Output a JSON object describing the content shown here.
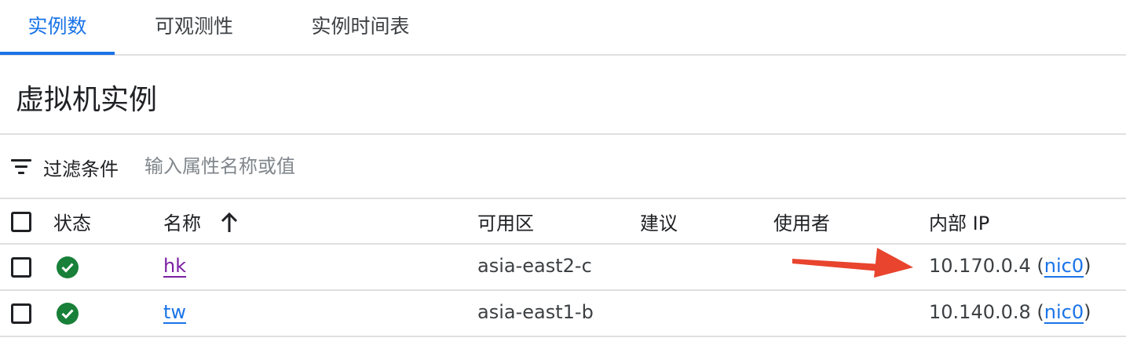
{
  "tabs": [
    {
      "label": "实例数",
      "active": true
    },
    {
      "label": "可观测性",
      "active": false
    },
    {
      "label": "实例时间表",
      "active": false
    }
  ],
  "page_title": "虚拟机实例",
  "filter": {
    "label": "过滤条件",
    "placeholder": "输入属性名称或值",
    "icon": "filter-list-icon"
  },
  "table": {
    "headers": {
      "status": "状态",
      "name": "名称",
      "zone": "可用区",
      "recommendation": "建议",
      "in_use_by": "使用者",
      "internal_ip": "内部 IP"
    },
    "sort": {
      "column": "name",
      "direction": "ascending",
      "icon": "arrow-upward-icon"
    },
    "rows": [
      {
        "status": "running",
        "status_icon": "check-circle-icon",
        "name": "hk",
        "zone": "asia-east2-c",
        "ip": "10.170.0.4",
        "ip_open": " (",
        "nic": "nic0",
        "ip_close": ")"
      },
      {
        "status": "running",
        "status_icon": "check-circle-icon",
        "name": "tw",
        "zone": "asia-east1-b",
        "ip": "10.140.0.8",
        "ip_open": " (",
        "nic": "nic0",
        "ip_close": ")"
      }
    ]
  },
  "annotation": {
    "type": "red-arrow",
    "color": "#e8442e",
    "points_to": "rows.0.ip"
  },
  "colors": {
    "accent": "#1a73e8",
    "success": "#188038",
    "visited_link": "#7b1fa2",
    "divider": "#e0e0e0"
  }
}
